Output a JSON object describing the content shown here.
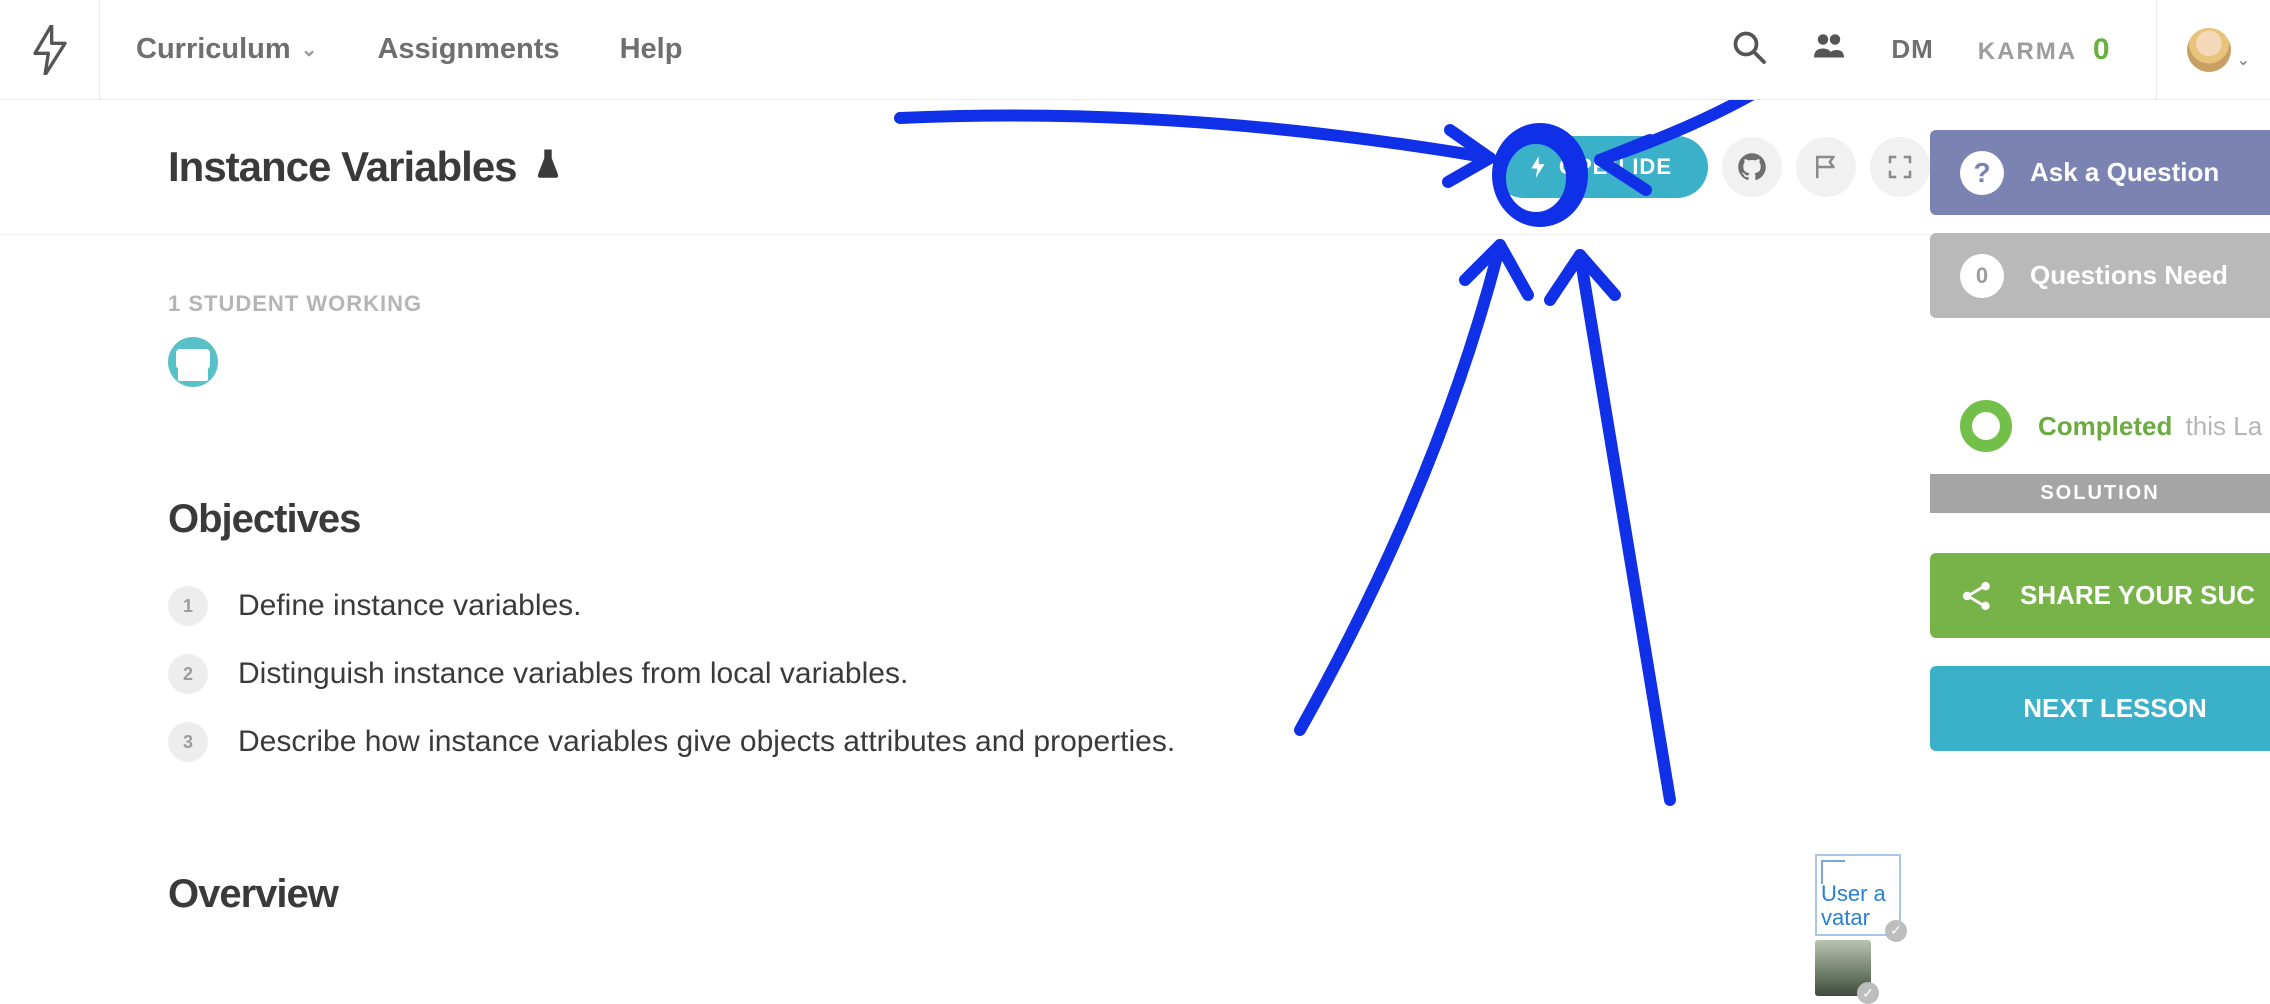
{
  "nav": {
    "curriculum": "Curriculum",
    "assignments": "Assignments",
    "help": "Help",
    "dm": "DM",
    "karma_label": "KARMA",
    "karma_value": "0"
  },
  "page": {
    "title": "Instance Variables",
    "open_ide": "OPEN IDE",
    "students_working": "1 STUDENT WORKING"
  },
  "objectives": {
    "heading": "Objectives",
    "items": [
      "Define instance variables.",
      "Distinguish instance variables from local variables.",
      "Describe how instance variables give objects attributes and properties."
    ]
  },
  "overview": {
    "heading": "Overview"
  },
  "side": {
    "ask": "Ask a Question",
    "questions_need_count": "0",
    "questions_need_label": "Questions Need",
    "completed": "Completed",
    "completed_suffix": "this La",
    "solution": "SOLUTION",
    "share": "SHARE YOUR SUC",
    "next": "NEXT LESSON"
  },
  "thumbs": {
    "alt": "User avatar"
  }
}
